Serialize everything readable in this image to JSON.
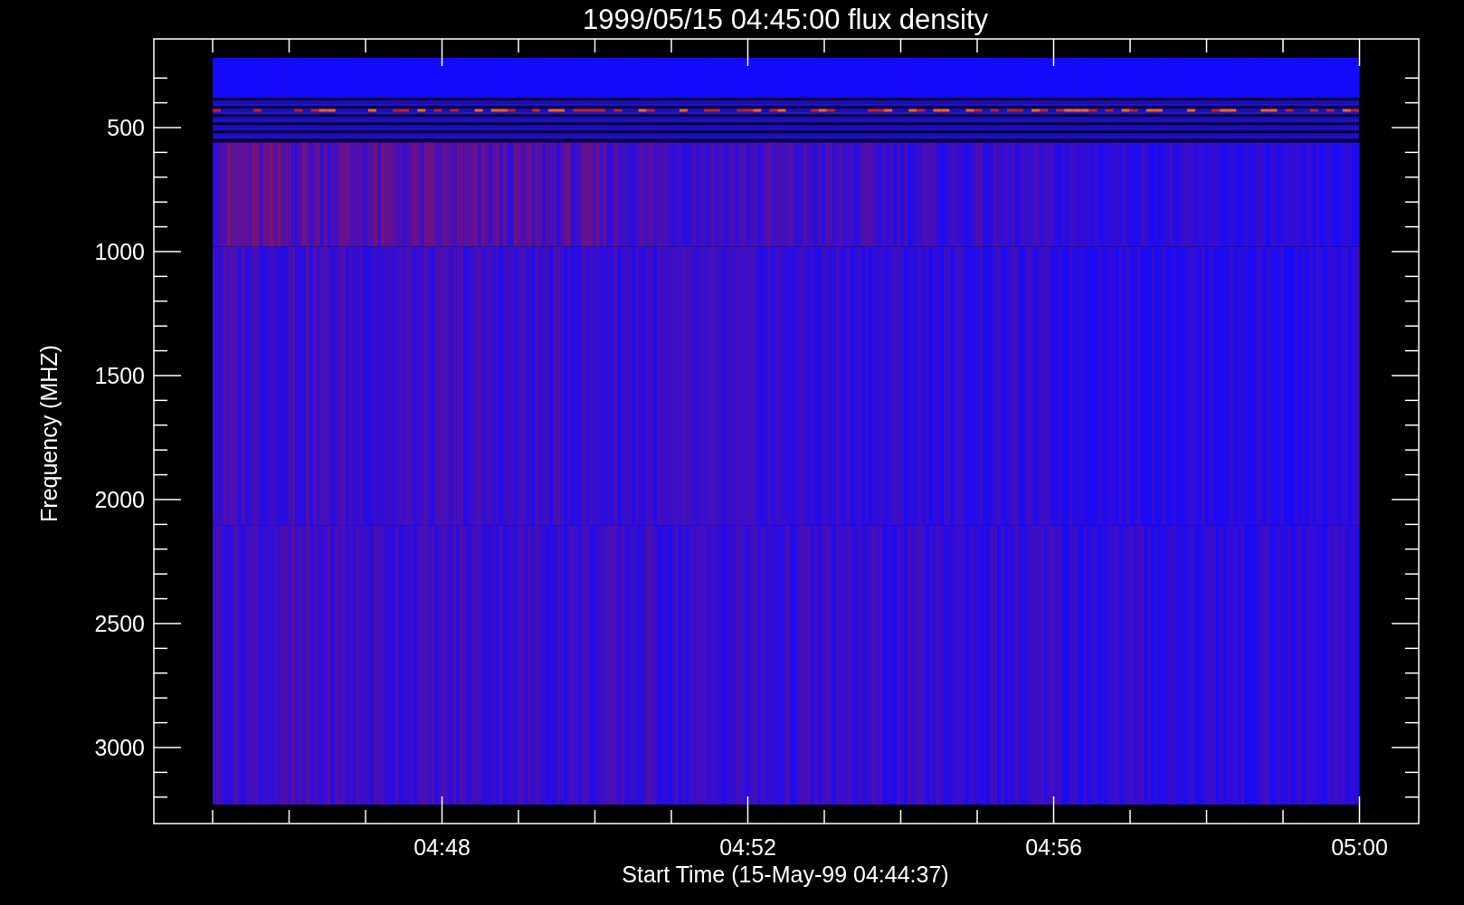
{
  "plot": {
    "title": "1999/05/15 04:45:00 flux density",
    "ylabel": "Frequency (MHZ)",
    "xlabel": "Start Time (15-May-99 04:44:37)",
    "yticks": [
      "500",
      "1000",
      "1500",
      "2000",
      "2500",
      "3000"
    ],
    "xticks": [
      "04:48",
      "04:52",
      "04:56",
      "05:00"
    ]
  }
}
